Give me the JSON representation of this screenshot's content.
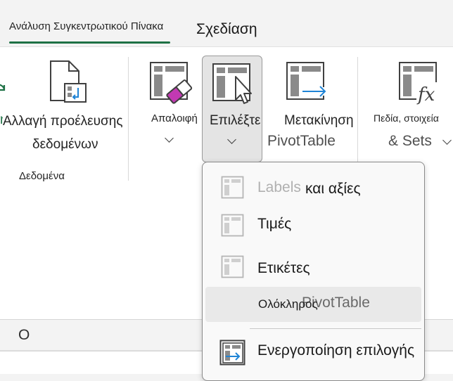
{
  "tabs": {
    "analyze": "Ανάλυση Συγκεντρωτικού Πίνακα",
    "design": "Σχεδίαση"
  },
  "ribbon": {
    "change_source_line1": "Αλλαγή προέλευσης",
    "change_source_line2": "δεδομένων",
    "data_group_label": "Δεδομένα",
    "clear_label": "Απαλοιφή",
    "select_label": "Επιλέξτε",
    "move_label": "Μετακίνηση",
    "move_sublabel": "PivotTable",
    "fields_label": "Πεδία, στοιχεία",
    "fields_sublabel": "& Sets"
  },
  "sheet": {
    "column_header": "O"
  },
  "menu": {
    "items": [
      {
        "label_ghost": "Labels",
        "label": "και αξίες"
      },
      {
        "label": "Τιμές"
      },
      {
        "label": "Ετικέτες"
      },
      {
        "label_overlay": "PivotTable",
        "label": "Ολόκληρος"
      },
      {
        "label": "Ενεργοποίηση επιλογής"
      }
    ]
  },
  "colors": {
    "accent_green": "#1e7145",
    "clear_icon_magenta": "#c239b3",
    "move_arrow_blue": "#1f84d6"
  },
  "icons": {
    "change_source": "document-refresh-icon",
    "clear": "table-eraser-icon",
    "select": "table-cursor-icon",
    "move": "table-arrow-icon",
    "fields": "table-formula-icon",
    "labels_values": "table-icon",
    "values": "table-icon",
    "labels": "table-icon",
    "enable_selection": "table-select-icon"
  }
}
